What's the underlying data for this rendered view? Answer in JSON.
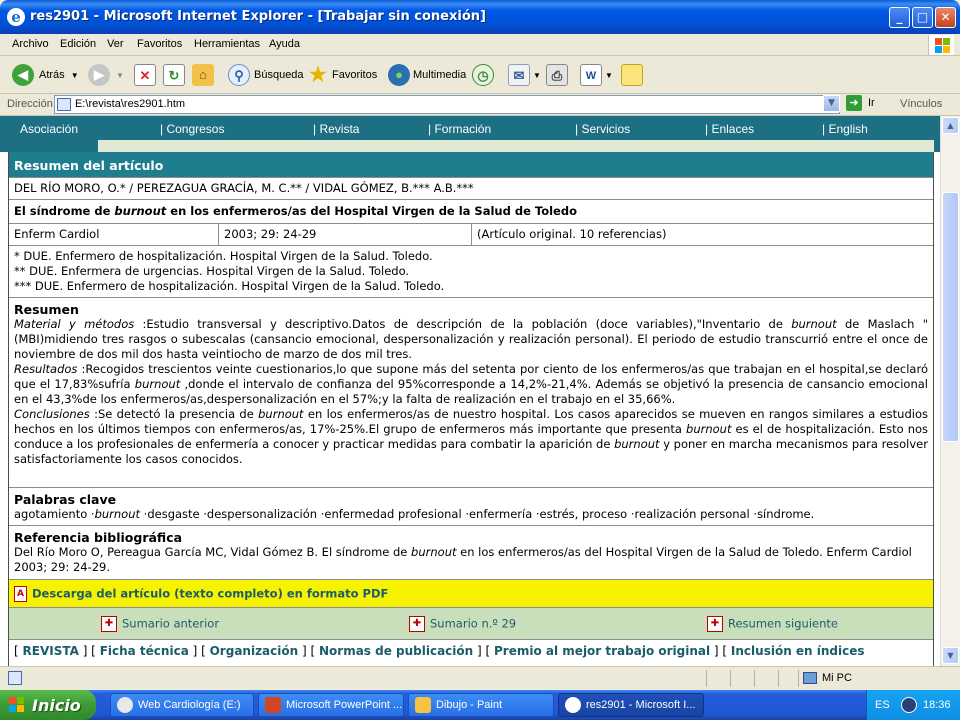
{
  "window": {
    "title": "res2901 - Microsoft Internet Explorer - [Trabajar sin conexión]"
  },
  "menu": [
    "Archivo",
    "Edición",
    "Ver",
    "Favoritos",
    "Herramientas",
    "Ayuda"
  ],
  "toolbar": {
    "back": "Atrás",
    "search": "Búsqueda",
    "favorites": "Favoritos",
    "multimedia": "Multimedia"
  },
  "address": {
    "label": "Dirección",
    "value": "E:\\revista\\res2901.htm",
    "go": "Ir",
    "links": "Vínculos"
  },
  "site_nav": [
    "Asociación",
    "| Congresos",
    "| Revista",
    "| Formación",
    "| Servicios",
    "| Enlaces",
    "| English"
  ],
  "article": {
    "section_title": "Resumen del artículo",
    "authors": "DEL RÍO MORO, O.* / PEREZAGUA GRACÍA, M. C.** / VIDAL GÓMEZ, B.*** A.B.***",
    "title_pre": "El síndrome de ",
    "title_em": "burnout",
    "title_post": " en los enfermeros/as del Hospital Virgen de la Salud de Toledo",
    "journal": "Enferm Cardiol",
    "issue": "2003; 29: 24-29",
    "type": "(Artículo original. 10 referencias)",
    "affiliations": [
      "* DUE. Enfermero de hospitalización. Hospital Virgen de la Salud. Toledo.",
      "** DUE. Enfermera de urgencias. Hospital Virgen de la Salud. Toledo.",
      "*** DUE. Enfermero de hospitalización. Hospital Virgen de la Salud. Toledo."
    ],
    "resumen_heading": "Resumen",
    "methods_label": "Material y métodos",
    "methods_a": " :Estudio transversal y descriptivo.Datos de descripción de la población (doce variables),\"Inventario de ",
    "methods_em": "burnout",
    "methods_b": " de Maslach \"(MBI)midiendo tres rasgos o subescalas (cansancio emocional, despersonalización y realización personal). El periodo de estudio transcurrió entre el once de noviembre de dos mil dos hasta veintiocho de marzo de dos mil tres.",
    "results_label": "Resultados",
    "results_a": " :Recogidos trescientos veinte cuestionarios,lo que supone más del setenta por ciento de los enfermeros/as que trabajan en el hospital,se declaró que el 17,83%sufría ",
    "results_em": "burnout",
    "results_b": " ,donde el intervalo de confianza del 95%corresponde a 14,2%-21,4%.  Además se objetivó la presencia de cansancio emocional en el 43,3%de los enfermeros/as,despersonalización en el 57%;y la falta de realización en el trabajo en el 35,66%.",
    "conclusions_label": "Conclusiones",
    "conclusions_a": " :Se detectó la presencia de ",
    "conclusions_em1": "burnout",
    "conclusions_b": " en los enfermeros/as de nuestro hospital. Los casos aparecidos se mueven en rangos similares a estudios hechos en los últimos tiempos con enfermeros/as, 17%-25%.El grupo de enfermeros más importante que presenta ",
    "conclusions_em2": "burnout",
    "conclusions_c": " es el de hospitalización. Esto nos conduce a los profesionales de enfermería a conocer y practicar medidas para combatir la aparición de ",
    "conclusions_em3": "burnout",
    "conclusions_d": " y poner en marcha mecanismos para resolver satisfactoriamente los casos conocidos.",
    "keywords_heading": "Palabras clave",
    "keywords_a": "agotamiento ·",
    "keywords_em": "burnout",
    "keywords_b": " ·desgaste ·despersonalización ·enfermedad profesional ·enfermería ·estrés, proceso ·realización personal ·síndrome.",
    "ref_heading": "Referencia bibliográfica",
    "ref_a": "Del Río Moro O, Pereagua García MC, Vidal Gómez B. El síndrome de ",
    "ref_em": "burnout",
    "ref_b": " en los enfermeros/as del Hospital Virgen de la Salud de Toledo. Enferm Cardiol 2003; 29: 24-29.",
    "download": "Descarga del artículo (texto completo) en formato PDF",
    "nav_prev": "Sumario anterior",
    "nav_issue": "Sumario n.º 29",
    "nav_next": "Resumen siguiente",
    "footer_links": [
      "REVISTA",
      "Ficha técnica",
      "Organización",
      "Normas de publicación",
      "Premio al mejor trabajo original",
      "Inclusión en índices"
    ]
  },
  "statusbar": {
    "zone": "Mi PC"
  },
  "taskbar": {
    "start": "Inicio",
    "tasks": [
      "Web Cardiología (E:)",
      "Microsoft PowerPoint ...",
      "Dibujo - Paint",
      "res2901 - Microsoft I..."
    ],
    "lang": "ES",
    "clock": "18:36"
  }
}
